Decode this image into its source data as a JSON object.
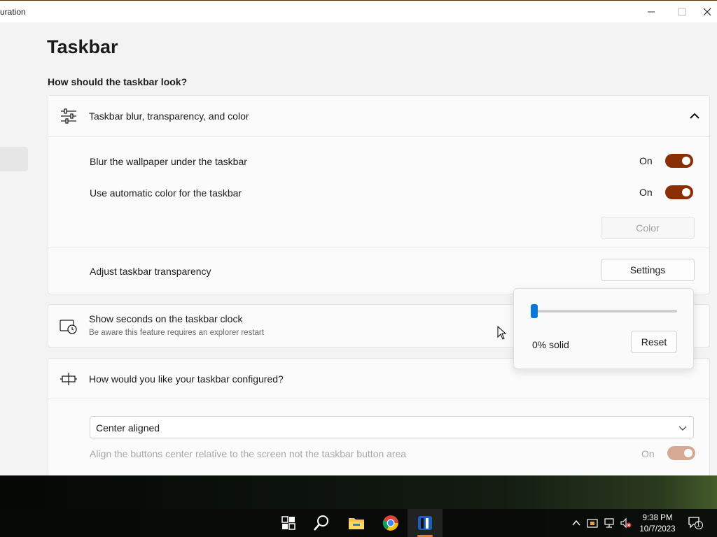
{
  "window": {
    "title": "uration"
  },
  "page": {
    "title": "Taskbar",
    "section_heading": "How should the taskbar look?"
  },
  "expander": {
    "label": "Taskbar blur, transparency, and color",
    "rows": [
      {
        "label": "Blur the wallpaper under the taskbar",
        "state": "On"
      },
      {
        "label": "Use automatic color for the taskbar",
        "state": "On"
      }
    ],
    "color_button": "Color",
    "transparency_label": "Adjust taskbar transparency",
    "settings_button": "Settings"
  },
  "flyout": {
    "value_text": "0% solid",
    "reset_button": "Reset",
    "slider_value": 0
  },
  "seconds_card": {
    "label": "Show seconds on the taskbar clock",
    "description": "Be aware this feature requires an explorer restart"
  },
  "config_card": {
    "label": "How would you like your taskbar configured?",
    "dropdown_value": "Center aligned",
    "align_label": "Align the buttons center relative to the screen not the taskbar button area",
    "align_state": "On"
  },
  "taskbar": {
    "time": "9:38 PM",
    "date": "10/7/2023",
    "notification_count": "1"
  },
  "colors": {
    "accent": "#8a2e03",
    "accent_dim": "#d6a995",
    "slider": "#0a78d4"
  }
}
